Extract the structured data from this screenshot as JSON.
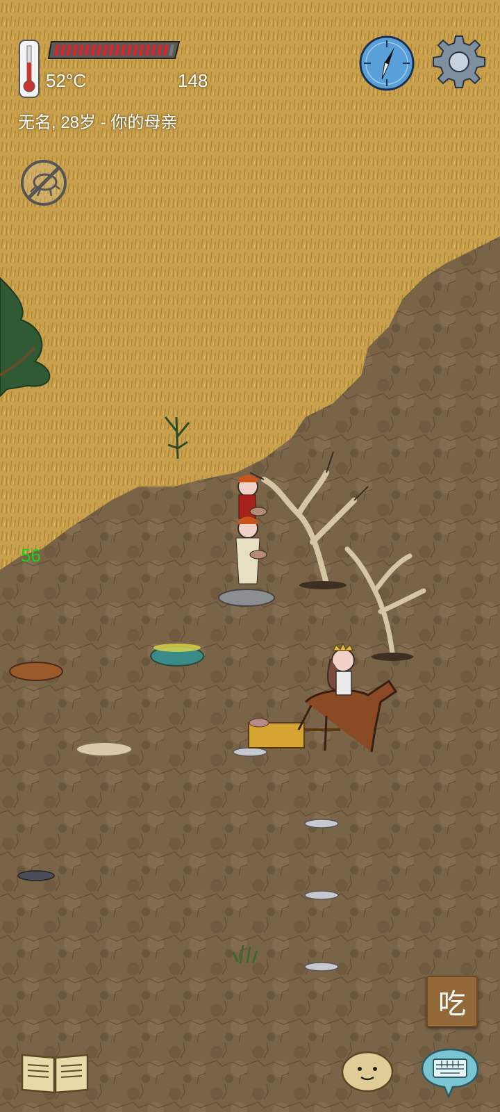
{
  "hud": {
    "temperature": "52°C",
    "score": "148",
    "identity": "无名, 28岁 - 你的母亲",
    "health_fraction": 0.93,
    "health_segments": 20
  },
  "counter": "56",
  "buttons": {
    "eat_label": "吃"
  },
  "icons": {
    "thermometer": "thermometer-icon",
    "compass": "compass-icon",
    "settings": "gear-icon",
    "no_insect": "no-insect-icon",
    "book": "book-icon",
    "emote": "potato-face-icon",
    "keyboard": "keyboard-icon"
  },
  "colors": {
    "grassland": "#c89f4a",
    "badlands": "#7a6448",
    "health": "#d9262b",
    "counter_text": "#19d21b",
    "eat_button": "#93693a"
  }
}
